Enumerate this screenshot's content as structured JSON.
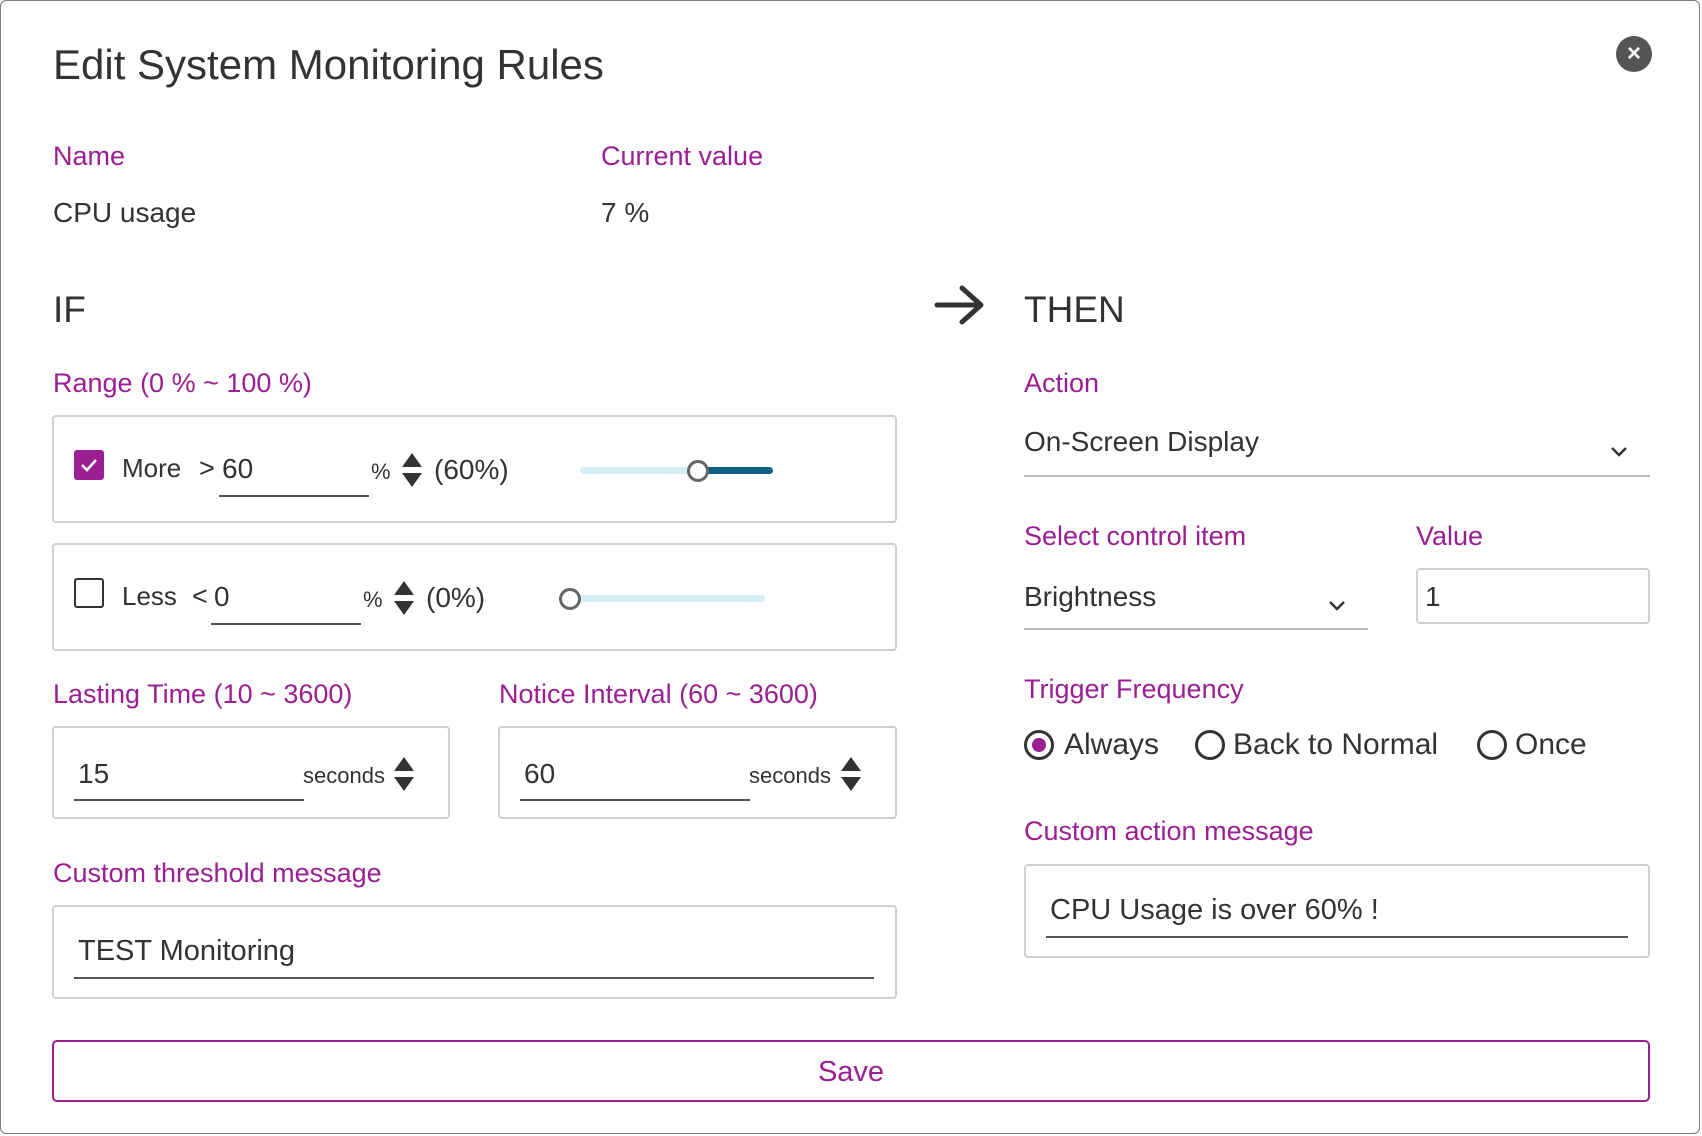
{
  "dialog": {
    "title": "Edit System Monitoring Rules",
    "close_label": "×"
  },
  "info": {
    "name_label": "Name",
    "name_value": "CPU usage",
    "current_label": "Current value",
    "current_value": "7 %"
  },
  "if_section": {
    "heading": "IF",
    "range_label": "Range (0 % ~ 100 %)",
    "more": {
      "checked": true,
      "label": "More",
      "operator": ">",
      "value": "60",
      "unit": "%",
      "display": "(60%)",
      "slider_percent": 60
    },
    "less": {
      "checked": false,
      "label": "Less",
      "operator": "<",
      "value": "0",
      "unit": "%",
      "display": "(0%)",
      "slider_percent": 0
    },
    "lasting_label": "Lasting Time (10 ~ 3600)",
    "lasting_value": "15",
    "lasting_unit": "seconds",
    "interval_label": "Notice Interval (60 ~ 3600)",
    "interval_value": "60",
    "interval_unit": "seconds",
    "threshold_label": "Custom threshold message",
    "threshold_value": "TEST Monitoring"
  },
  "arrow_icon": "arrow-right-icon",
  "then_section": {
    "heading": "THEN",
    "action_label": "Action",
    "action_value": "On-Screen Display",
    "control_label": "Select control item",
    "control_value": "Brightness",
    "value_label": "Value",
    "value_value": "1",
    "frequency_label": "Trigger Frequency",
    "frequency_options": [
      {
        "label": "Always",
        "selected": true
      },
      {
        "label": "Back to Normal",
        "selected": false
      },
      {
        "label": "Once",
        "selected": false
      }
    ],
    "action_message_label": "Custom action message",
    "action_message_value": "CPU Usage is over 60% !"
  },
  "save_label": "Save",
  "colors": {
    "accent": "#9b1f93",
    "slider_active": "#0d5f86",
    "slider_inactive": "#d6eef6"
  }
}
